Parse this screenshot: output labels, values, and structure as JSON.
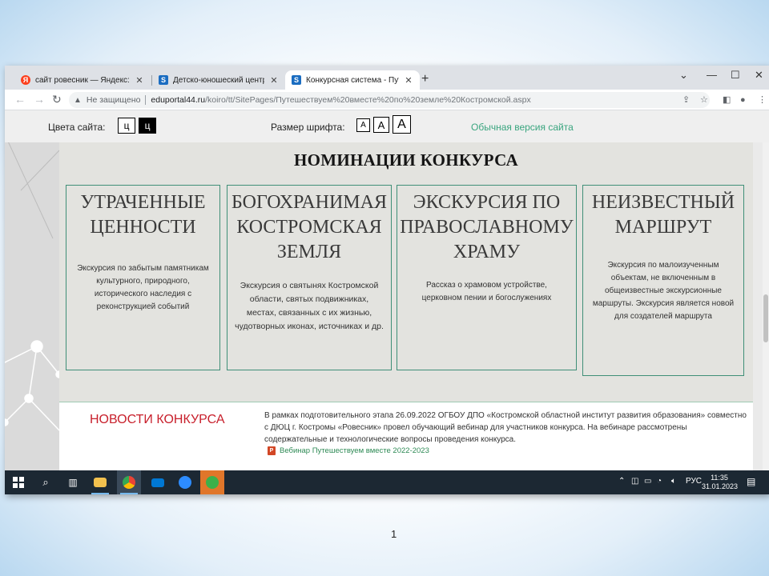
{
  "browser": {
    "tabs": [
      {
        "title": "сайт ровесник — Яндекс: нашлось",
        "favicon": "yandex-icon"
      },
      {
        "title": "Детско-юношеский центр город",
        "favicon": "sharepoint-icon"
      },
      {
        "title": "Конкурсная система - Путешест",
        "favicon": "sharepoint-icon"
      }
    ],
    "new_tab_glyph": "+",
    "address": {
      "security": "Не защищено",
      "domain": "eduportal44.ru",
      "path": "/koiro/tt/SitePages/Путешествуем%20вместе%20по%20земле%20Костромской.aspx"
    }
  },
  "accessibility_bar": {
    "colors_label": "Цвета сайта:",
    "color_white_btn": "ц",
    "color_black_btn": "ц",
    "font_size_label": "Размер шрифта:",
    "font_btn_small": "А",
    "font_btn_medium": "А",
    "font_btn_large": "А",
    "normal_version_link": "Обычная версия сайта"
  },
  "nominations": {
    "title": "НОМИНАЦИИ КОНКУРСА",
    "cards": [
      {
        "title": "УТРАЧЕННЫЕ ЦЕННОСТИ",
        "description": "Экскурсия по забытым памятникам культурного, природного, исторического наследия с реконструкцией событий"
      },
      {
        "title": "БОГОХРАНИМАЯ КОСТРОМСКАЯ ЗЕМЛЯ",
        "description": "Экскурсия о святынях Костромской области, святых подвижниках, местах, связанных с их жизнью, чудотворных иконах, источниках и др."
      },
      {
        "title": "ЭКСКУРСИЯ ПО ПРАВОСЛАВНОМУ ХРАМУ",
        "description": "Рассказ о храмовом устройстве, церковном пении и богослужениях"
      },
      {
        "title": "НЕИЗВЕСТНЫЙ МАРШРУТ",
        "description": "Экскурсия по малоизученным объектам, не включенным в общеизвестные экскурсионные маршруты. Экскурсия является новой для создателей маршрута"
      }
    ]
  },
  "news": {
    "title": "НОВОСТИ КОНКУРСА",
    "text": "В рамках подготовительного этапа 26.09.2022  ОГБОУ ДПО «Костромской областной институт развития образования» совместно с ДЮЦ г. Костромы «Ровесник» провел обучающий вебинар для участников конкурса. На вебинаре рассмотрены содержательные и технологические вопросы проведения конкурса.",
    "attachment": "Вебинар Путешествуем вместе 2022-2023"
  },
  "taskbar": {
    "language": "РУС",
    "time": "11:35",
    "date": "31.01.2023"
  },
  "slide_number": "1",
  "colors": {
    "accent_green": "#3aa57f",
    "card_border": "#3f8f77",
    "news_red": "#c8202c",
    "taskbar": "#1c2833"
  }
}
